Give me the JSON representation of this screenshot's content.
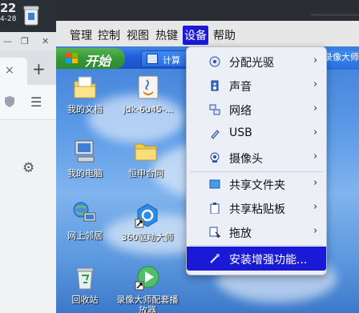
{
  "host": {
    "clock_time": "22",
    "clock_date": "4-28",
    "new_tab_symbol": "+",
    "close_tab_symbol": "×"
  },
  "vm_menu": {
    "items": [
      {
        "label": "管理"
      },
      {
        "label": "控制"
      },
      {
        "label": "视图"
      },
      {
        "label": "热键"
      },
      {
        "label": "设备",
        "active": true
      },
      {
        "label": "帮助"
      }
    ]
  },
  "guest": {
    "start_label": "开始",
    "taskbar_items": [
      {
        "label": "计算"
      },
      {
        "label": "录像大师"
      }
    ],
    "desktop_icons": [
      {
        "label": "我的文档",
        "icon": "my-documents-icon"
      },
      {
        "label": "jdk-6u45-...",
        "icon": "java-installer-icon"
      },
      {
        "label": "我的电脑",
        "icon": "my-computer-icon"
      },
      {
        "label": "恒申合同",
        "icon": "folder-icon"
      },
      {
        "label": "网上邻居",
        "icon": "network-places-icon"
      },
      {
        "label": "360驱动大师",
        "icon": "driver-master-icon"
      },
      {
        "label": "回收站",
        "icon": "recycle-bin-icon"
      },
      {
        "label": "录像大师配套播放器",
        "icon": "video-player-icon"
      }
    ]
  },
  "devices_menu": {
    "items": [
      {
        "label": "分配光驱",
        "icon": "optical-drive-icon",
        "submenu": true
      },
      {
        "label": "声音",
        "icon": "audio-icon",
        "submenu": true
      },
      {
        "label": "网络",
        "icon": "network-icon",
        "submenu": true
      },
      {
        "label": "USB",
        "icon": "usb-icon",
        "submenu": true
      },
      {
        "label": "摄像头",
        "icon": "webcam-icon",
        "submenu": true
      },
      {
        "label": "共享文件夹",
        "icon": "shared-folder-icon",
        "submenu": true
      },
      {
        "label": "共享粘贴板",
        "icon": "clipboard-icon",
        "submenu": true
      },
      {
        "label": "拖放",
        "icon": "drag-drop-icon",
        "submenu": true
      },
      {
        "label": "安装增强功能...",
        "icon": "guest-additions-icon",
        "submenu": false,
        "highlighted": true
      }
    ],
    "arrow_symbol": "›"
  },
  "colors": {
    "highlight": "#1a1ad6",
    "menubar": "#e7e7e7",
    "menu_bg": "#eceff6",
    "xp_taskbar": "#245edb",
    "xp_start": "#3a9a3a"
  }
}
